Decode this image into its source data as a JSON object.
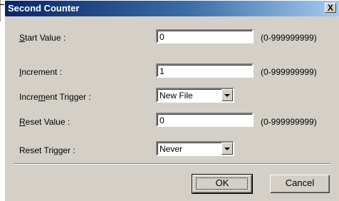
{
  "title": "Second Counter",
  "close_label": "X",
  "rows": [
    {
      "label_parts": [
        "",
        "S",
        "tart Value :"
      ],
      "value": "0",
      "range": "(0-999999999)"
    },
    {
      "label_parts": [
        "",
        "I",
        "ncrement :"
      ],
      "value": "1",
      "range": "(0-999999999)"
    },
    {
      "label_parts": [
        "Incre",
        "m",
        "ent Trigger :"
      ],
      "selected": "New File"
    },
    {
      "label_parts": [
        "",
        "R",
        "eset Value :"
      ],
      "value": "0",
      "range": "(0-999999999)"
    },
    {
      "label_parts": [
        "Reset Tri",
        "g",
        "ger :"
      ],
      "selected": "Never"
    }
  ],
  "buttons": {
    "ok": "OK",
    "cancel": "Cancel"
  }
}
